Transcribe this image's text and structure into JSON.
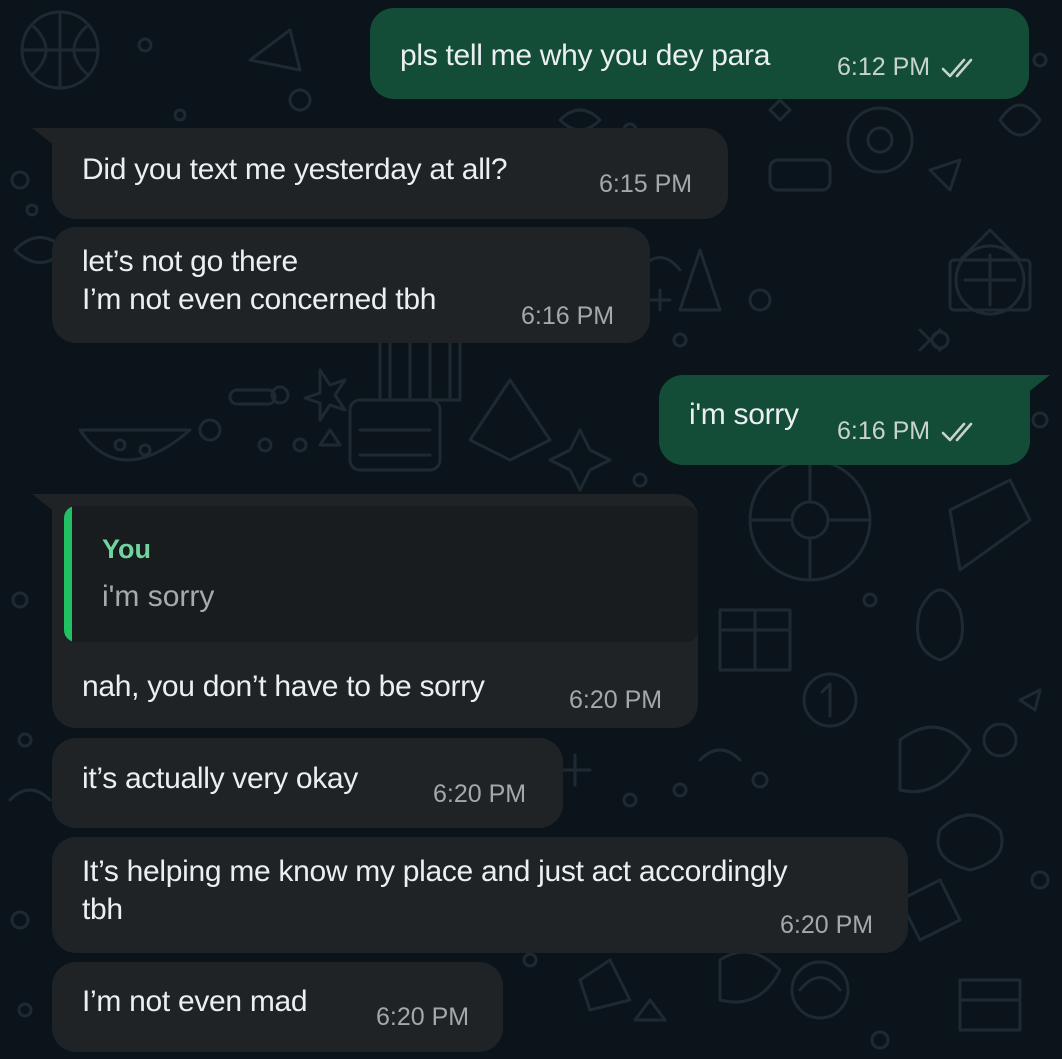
{
  "messages": [
    {
      "direction": "out",
      "text": "pls tell me why you dey para",
      "time": "6:12 PM",
      "status": "read-double-check-icon"
    },
    {
      "direction": "in",
      "text": "Did you text me yesterday at all?",
      "time": "6:15 PM"
    },
    {
      "direction": "in",
      "text": "let’s not go there\nI’m not even concerned tbh",
      "time": "6:16 PM"
    },
    {
      "direction": "out",
      "text": "i'm sorry",
      "time": "6:16 PM",
      "status": "read-double-check-icon"
    },
    {
      "direction": "in",
      "quote": {
        "author": "You",
        "text": "i'm sorry"
      },
      "text": "nah, you don’t have to be sorry",
      "time": "6:20 PM"
    },
    {
      "direction": "in",
      "text": "it’s actually very okay",
      "time": "6:20 PM"
    },
    {
      "direction": "in",
      "text": "It’s helping me know my place and just act accordingly\ntbh",
      "time": "6:20 PM"
    },
    {
      "direction": "in",
      "text": "I’m not even mad",
      "time": "6:20 PM"
    }
  ],
  "colors": {
    "background": "#0b141a",
    "incoming_bubble": "#1f2326",
    "outgoing_bubble": "#134d37",
    "quote_bar": "#21c063",
    "quote_author": "#71d4a0"
  }
}
